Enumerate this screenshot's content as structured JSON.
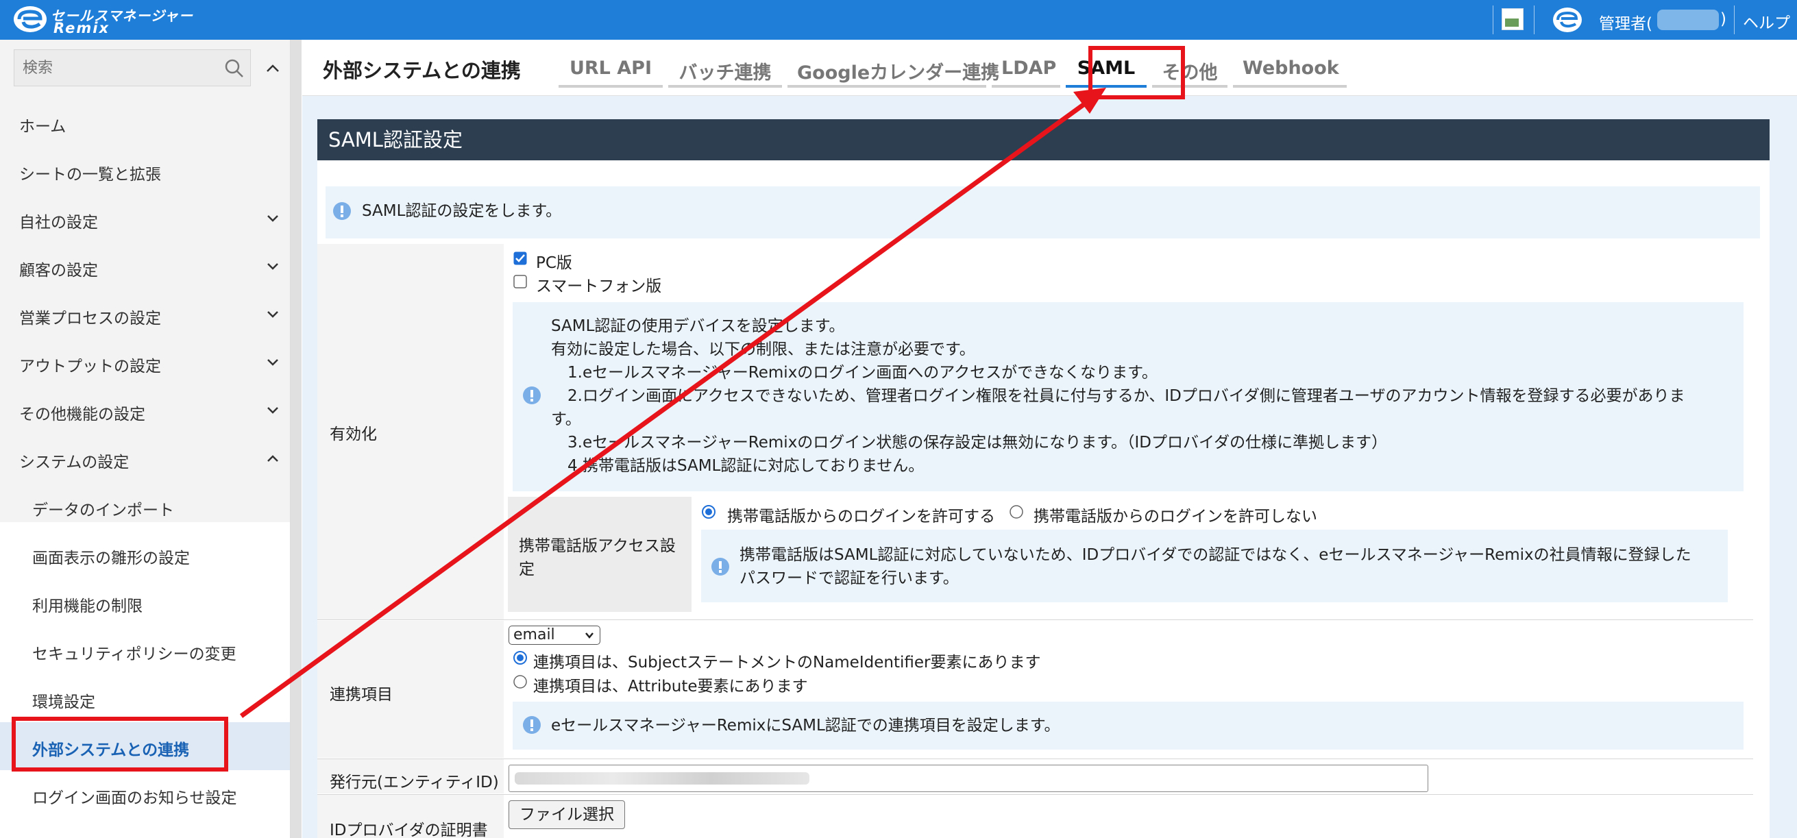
{
  "app": {
    "logo_line1": "セールスマネージャー",
    "logo_line2": "Remix",
    "user_label_prefix": "管理者(",
    "user_label_suffix": ")",
    "help_label": "ヘルプ"
  },
  "sidebar": {
    "search_placeholder": "検索",
    "items": [
      {
        "label": "ホーム"
      },
      {
        "label": "シートの一覧と拡張"
      },
      {
        "label": "自社の設定"
      },
      {
        "label": "顧客の設定"
      },
      {
        "label": "営業プロセスの設定"
      },
      {
        "label": "アウトプットの設定"
      },
      {
        "label": "その他機能の設定"
      },
      {
        "label": "システムの設定"
      }
    ],
    "sub_items": [
      {
        "label": "データのインポート"
      },
      {
        "label": "画面表示の雛形の設定"
      },
      {
        "label": "利用機能の制限"
      },
      {
        "label": "セキュリティポリシーの変更"
      },
      {
        "label": "環境設定"
      },
      {
        "label": "外部システムとの連携"
      },
      {
        "label": "ログイン画面のお知らせ設定"
      }
    ]
  },
  "main": {
    "title": "外部システムとの連携",
    "tabs": [
      {
        "label": "URL API"
      },
      {
        "label": "バッチ連携"
      },
      {
        "label": "Googleカレンダー連携"
      },
      {
        "label": "LDAP"
      },
      {
        "label": "SAML"
      },
      {
        "label": "その他"
      },
      {
        "label": "Webhook"
      }
    ],
    "active_tab": "SAML",
    "panel_title": "SAML認証設定",
    "intro_info": "SAML認証の設定をします。",
    "enable": {
      "label": "有効化",
      "pc_label": "PC版",
      "pc_checked": true,
      "smartphone_label": "スマートフォン版",
      "smartphone_checked": false,
      "info_lines": [
        "SAML認証の使用デバイスを設定します。",
        "有効に設定した場合、以下の制限、または注意が必要です。",
        "1.eセールスマネージャーRemixのログイン画面へのアクセスができなくなります。",
        "2.ログイン画面にアクセスできないため、管理者ログイン権限を社員に付与するか、IDプロバイダ側に管理者ユーザのアカウント情報を登録する必要がありま",
        "す。",
        "3.eセールスマネージャーRemixのログイン状態の保存設定は無効になります。（IDプロバイダの仕様に準拠します）",
        "4.携帯電話版はSAML認証に対応しておりません。"
      ],
      "mobile_access": {
        "label_line1": "携帯電話版アクセス設",
        "label_line2": "定",
        "allow_label": "携帯電話版からのログインを許可する",
        "deny_label": "携帯電話版からのログインを許可しない",
        "selected": "allow",
        "info_line1": "携帯電話版はSAML認証に対応していないため、IDプロバイダでの認証ではなく、eセールスマネージャーRemixの社員情報に登録した",
        "info_line2": "パスワードで認証を行います。"
      }
    },
    "link_item": {
      "label": "連携項目",
      "select_value": "email",
      "option1": "連携項目は、SubjectステートメントのNameIdentifier要素にあります",
      "option2": "連携項目は、Attribute要素にあります",
      "selected": "option1",
      "info": "eセールスマネージャーRemixにSAML認証での連携項目を設定します。"
    },
    "issuer": {
      "label": "発行元(エンティティID)"
    },
    "idp_cert": {
      "label": "IDプロバイダの証明書",
      "button_label": "ファイル選択"
    }
  },
  "colors": {
    "topbar": "#1f7fd8",
    "panel_header": "#2c3e50",
    "info_bg": "#ebf4fb",
    "annotation_red": "#e8141b",
    "active_link": "#1a63b4"
  }
}
